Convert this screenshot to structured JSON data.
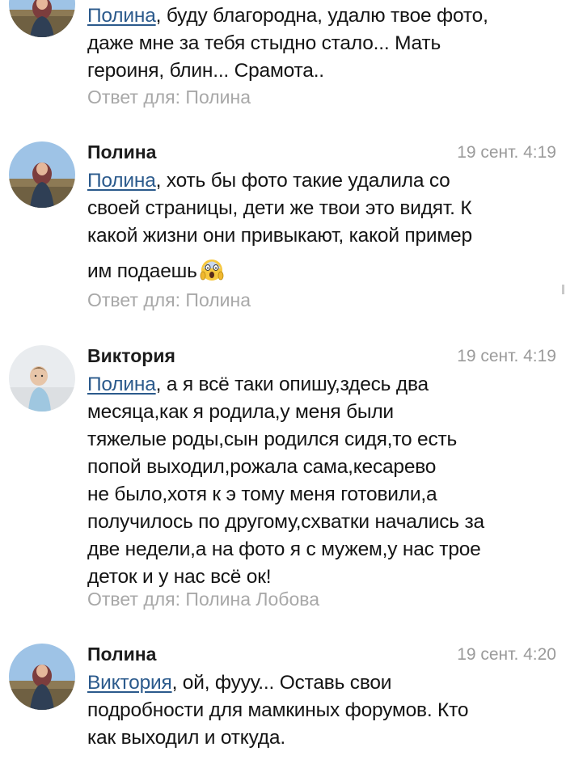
{
  "comments": [
    {
      "author": "",
      "date": "",
      "mention": "Полина",
      "lines": [
        "",
        "даже мне за тебя стыдно стало... Мать",
        "героиня, блин... Срамота.."
      ],
      "first_line_rest": ", буду благородна, удалю твое фото,",
      "reply": "Ответ для: Полина"
    },
    {
      "author": "Полина",
      "date": "19 сент. 4:19",
      "mention": "Полина",
      "first_line_rest": ", хоть бы фото такие удалила со",
      "lines": [
        "",
        "своей страницы, дети же твои это видят. К",
        "какой жизни они привыкают, какой пример",
        "им подаешь"
      ],
      "emoji": "screaming-face-emoji",
      "reply": "Ответ для: Полина"
    },
    {
      "author": "Виктория",
      "date": "19 сент. 4:19",
      "mention": "Полина",
      "first_line_rest": ", а я всё таки опишу,здесь два",
      "lines": [
        "",
        "месяца,как я родила,у меня были",
        "тяжелые роды,сын родился сидя,то есть",
        "попой выходил,рожала сама,кесарево",
        "не было,хотя к э тому меня готовили,а",
        "получилось по другому,схватки начались за",
        "две недели,а на фото я с мужем,у нас трое",
        "деток и у нас всё ок!"
      ],
      "reply": "Ответ для: Полина Лобова"
    },
    {
      "author": "Полина",
      "date": "19 сент. 4:20",
      "mention": "Виктория",
      "first_line_rest": ", ой, фууу... Оставь свои",
      "lines": [
        "",
        "подробности для мамкиных форумов. Кто",
        "как выходил и откуда."
      ]
    }
  ],
  "colors": {
    "mention": "#2b5a8c",
    "meta": "#9b9b9b",
    "text": "#141414"
  }
}
